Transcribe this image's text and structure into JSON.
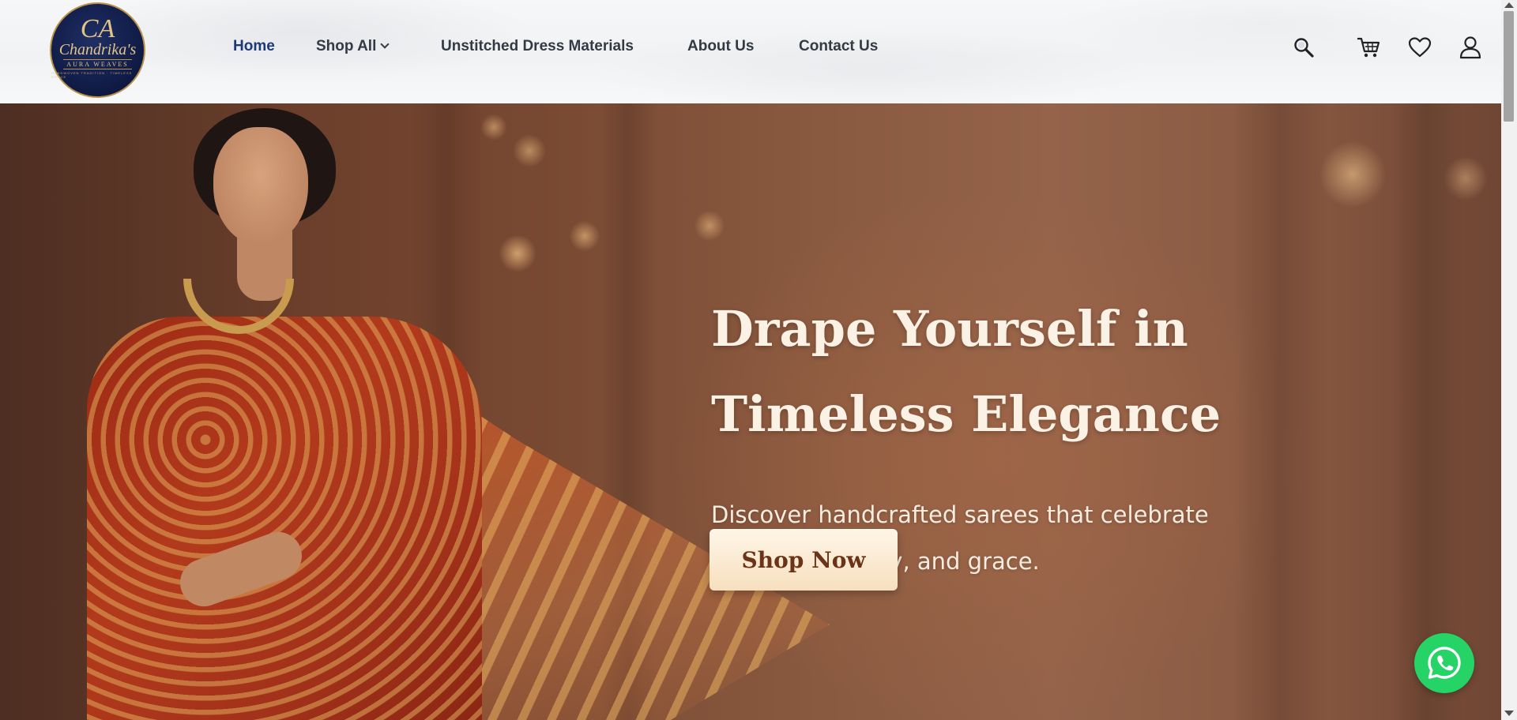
{
  "logo": {
    "monogram": "CA",
    "brand": "Chandrika's",
    "subtitle": "AURA WEAVES",
    "tagline": "HANDWOVEN TRADITION · TIMELESS GRACE"
  },
  "nav": {
    "items": [
      {
        "label": "Home",
        "active": true
      },
      {
        "label": "Shop All",
        "has_dropdown": true
      },
      {
        "label": "Unstitched Dress Materials"
      },
      {
        "label": "About Us"
      },
      {
        "label": "Contact Us"
      }
    ]
  },
  "header_icons": [
    "search-icon",
    "cart-icon",
    "heart-icon",
    "user-icon"
  ],
  "hero": {
    "title_line1": "Drape Yourself in",
    "title_line2": "Timeless Elegance",
    "subtitle_line1": "Discover handcrafted sarees that celebrate",
    "subtitle_line2": "tradition, beauty, and grace.",
    "cta_label": "Shop Now"
  },
  "floating": {
    "icon": "whatsapp-icon",
    "color": "#25d366"
  },
  "colors": {
    "nav_active": "#1d3a78",
    "nav_text": "#333a44",
    "cta_text": "#6b3418",
    "logo_bg": "#0f1a43",
    "logo_gold": "#e2c487"
  }
}
